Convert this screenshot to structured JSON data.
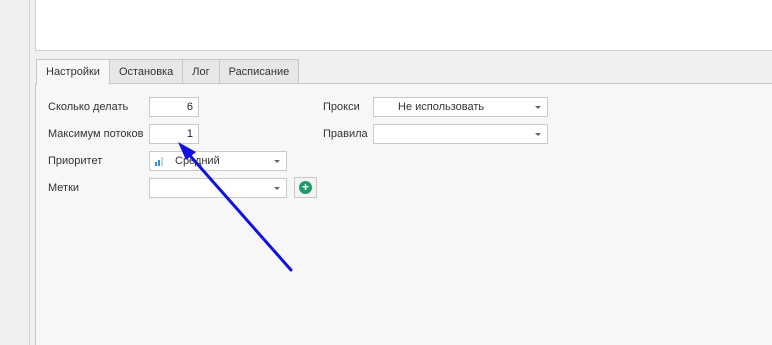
{
  "tabs": [
    {
      "label": "Настройки",
      "active": true
    },
    {
      "label": "Остановка",
      "active": false
    },
    {
      "label": "Лог",
      "active": false
    },
    {
      "label": "Расписание",
      "active": false
    }
  ],
  "settings": {
    "count_label": "Сколько делать",
    "count_value": "6",
    "threads_label": "Максимум потоков",
    "threads_value": "1",
    "priority_label": "Приоритет",
    "priority_value": "Средний",
    "tags_label": "Метки",
    "tags_value": "",
    "proxy_label": "Прокси",
    "proxy_value": "Не использовать",
    "rules_label": "Правила",
    "rules_value": ""
  },
  "colors": {
    "annotation_arrow": "#1010e0",
    "add_button": "#1e9a6a",
    "priority_icon": "#3a8fd6"
  },
  "icons": {
    "priority": "bar-chart-icon",
    "add_tag": "plus-circle-icon"
  }
}
